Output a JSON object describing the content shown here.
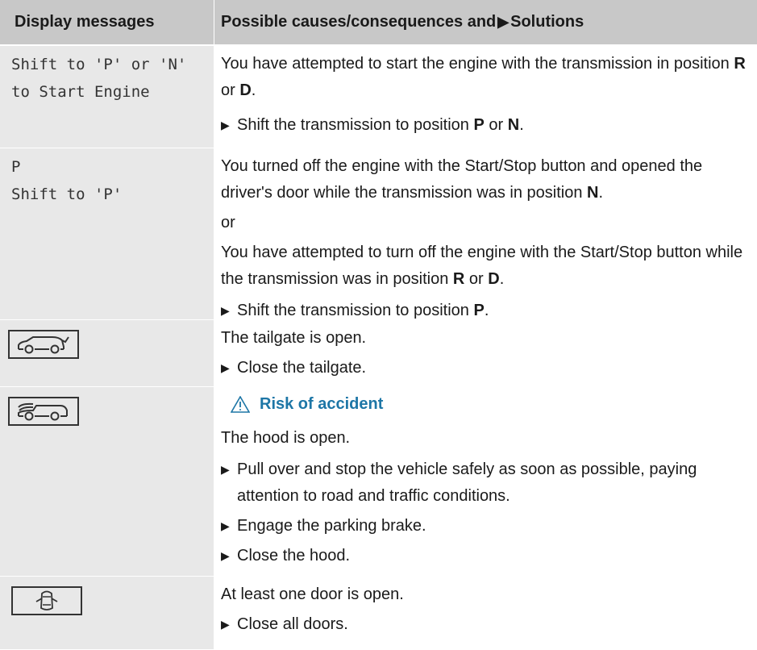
{
  "header": {
    "col1": "Display messages",
    "col2_before": "Possible causes/consequences and ",
    "col2_after": " Solutions"
  },
  "rows": [
    {
      "display_line1": "Shift to 'P' or 'N'",
      "display_line2": "to Start Engine",
      "cause_a": "You have attempted to start the engine with the transmission in position ",
      "cause_b": "R",
      "cause_c": " or ",
      "cause_d": "D",
      "cause_e": ".",
      "sol_a": "Shift the transmission to position ",
      "sol_b": "P",
      "sol_c": " or ",
      "sol_d": "N",
      "sol_e": "."
    },
    {
      "display_line1": "P",
      "display_line2": "Shift to 'P'",
      "cause1_a": "You turned off the engine with the Start/Stop button and opened the driver's door while the transmission was in position ",
      "cause1_b": "N",
      "cause1_c": ".",
      "or": "or",
      "cause2_a": "You have attempted to turn off the engine with the Start/Stop button while the transmission was in position ",
      "cause2_b": "R",
      "cause2_c": " or ",
      "cause2_d": "D",
      "cause2_e": ".",
      "sol_a": "Shift the transmission to position ",
      "sol_b": "P",
      "sol_c": "."
    },
    {
      "icon": "tailgate-open-icon",
      "cause": "The tailgate is open.",
      "sol": "Close the tailgate."
    },
    {
      "icon": "hood-open-icon",
      "warning": "Risk of accident",
      "cause": "The hood is open.",
      "sol1": "Pull over and stop the vehicle safely as soon as possible, paying attention to road and traffic conditions.",
      "sol2": "Engage the parking brake.",
      "sol3": "Close the hood."
    },
    {
      "icon": "door-open-icon",
      "cause": "At least one door is open.",
      "sol": "Close all doors."
    }
  ],
  "colors": {
    "header_bg": "#c8c8c8",
    "cell_bg": "#e8e8e8",
    "warning": "#1d76a6"
  }
}
